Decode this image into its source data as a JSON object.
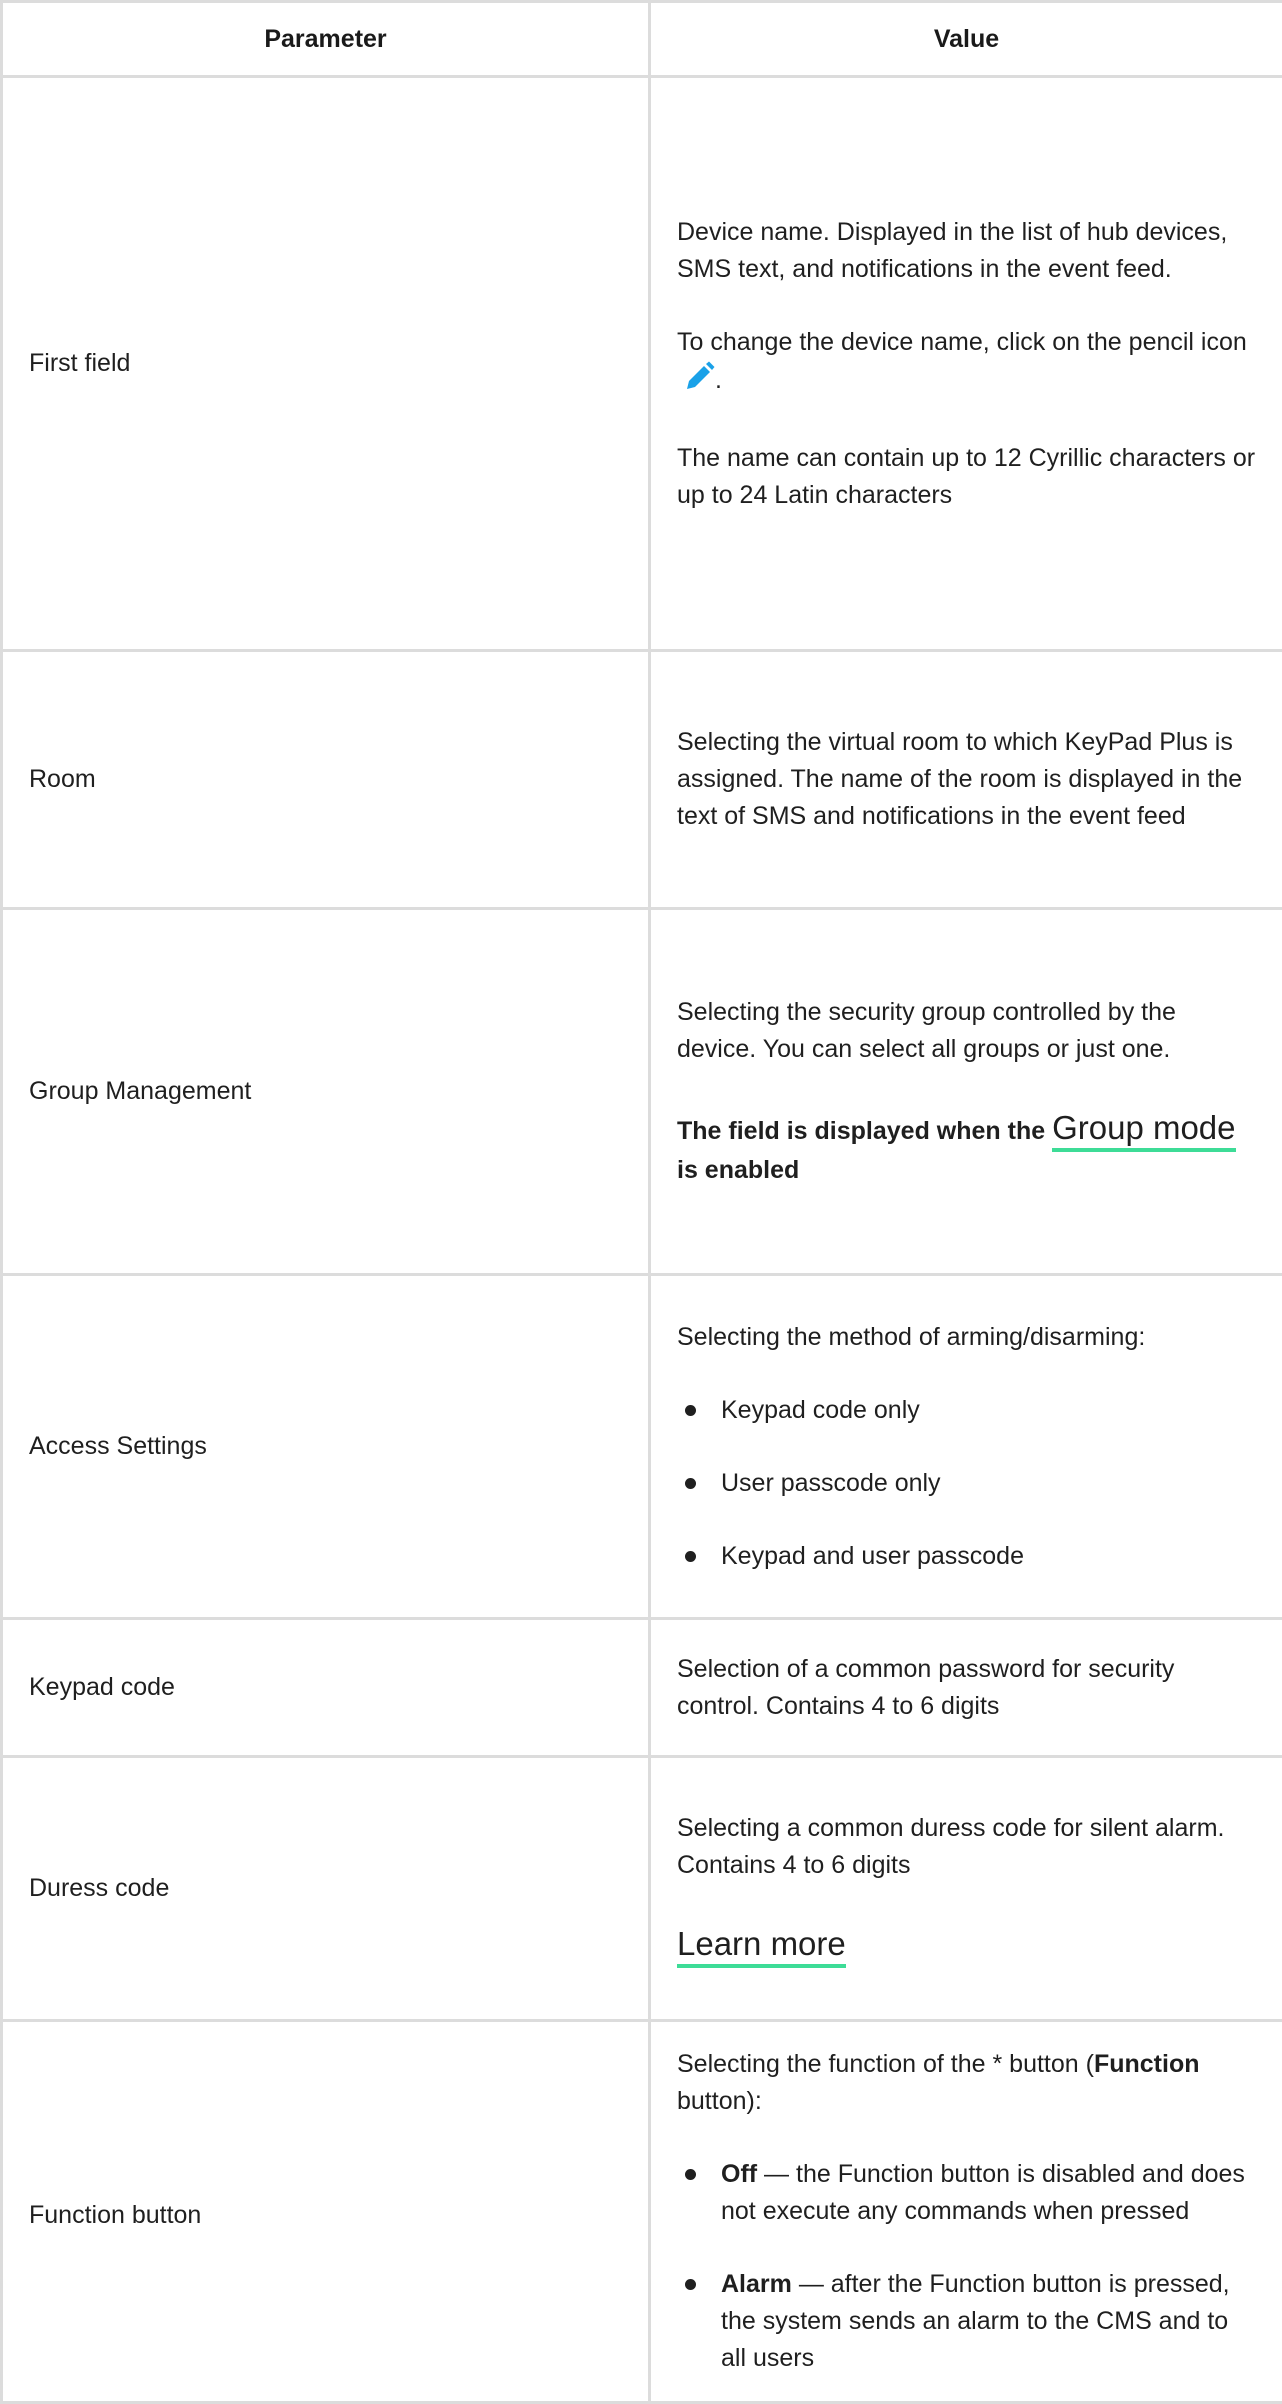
{
  "header": {
    "parameter": "Parameter",
    "value": "Value"
  },
  "rows": {
    "first_field": {
      "name": "First field",
      "p1": "Device name. Displayed in the list of hub devices, SMS text, and notifications in the event feed.",
      "p2_before_icon": "To change the device name, click on the pencil icon",
      "p2_after_icon": ".",
      "p3": "The name can contain up to 12 Cyrillic characters or up to 24 Latin characters",
      "icon": "pencil-icon",
      "icon_color": "#1aa1e8"
    },
    "room": {
      "name": "Room",
      "p1": "Selecting the virtual room to which KeyPad Plus is assigned. The name of the room is displayed in the text of SMS and notifications in the event feed"
    },
    "group_management": {
      "name": "Group Management",
      "p1": "Selecting the security group controlled by the device. You can select all groups or just one.",
      "note_before": "The field is displayed when the ",
      "note_link": "Group mode",
      "note_after": " is enabled"
    },
    "access_settings": {
      "name": "Access Settings",
      "p1": "Selecting the method of arming/disarming:",
      "options": [
        "Keypad code only",
        "User passcode only",
        "Keypad and user passcode"
      ]
    },
    "keypad_code": {
      "name": "Keypad code",
      "p1": "Selection of a common password for security control. Contains 4 to 6 digits"
    },
    "duress_code": {
      "name": "Duress code",
      "p1": "Selecting a common duress code for silent alarm. Contains 4 to 6 digits",
      "link": "Learn more"
    },
    "function_button": {
      "name": "Function button",
      "intro_before": "Selecting the function of the * button (",
      "intro_bold": "Function",
      "intro_after": " button):",
      "items": [
        {
          "term": "Off",
          "text": " — the Function button is disabled and does not execute any commands when pressed"
        },
        {
          "term": "Alarm",
          "text": " — after the Function button is pressed, the system sends an alarm to the CMS and to all users"
        }
      ]
    }
  },
  "colors": {
    "link_underline": "#3ddc97",
    "border": "#dcdcdc",
    "text": "#1f1f1f"
  }
}
